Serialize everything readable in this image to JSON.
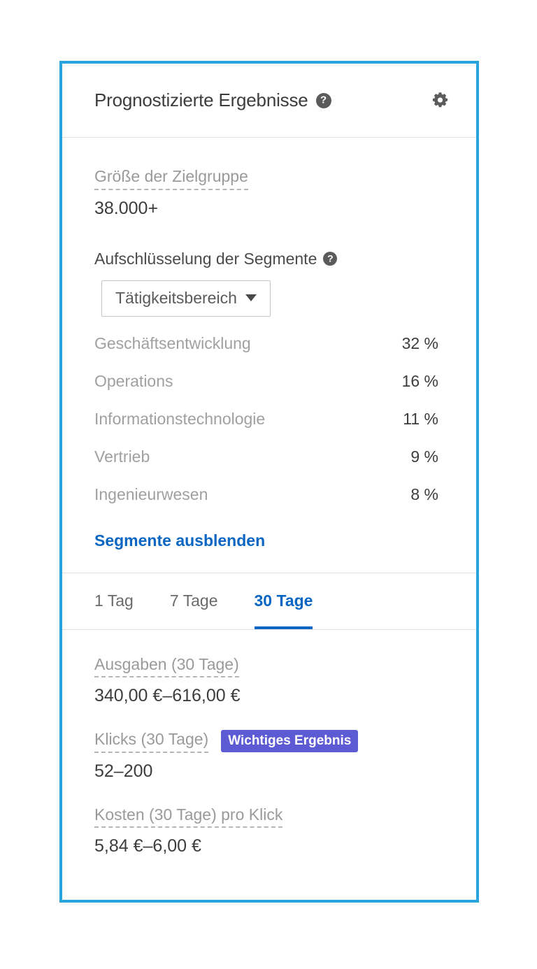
{
  "card": {
    "accent_border_color": "#29a3dc",
    "link_color": "#0a66c2",
    "badge_color": "#5d5bd4"
  },
  "header": {
    "title": "Prognostizierte Ergebnisse",
    "help_glyph": "?",
    "gear_icon_name": "gear-icon"
  },
  "audience": {
    "label": "Größe der Zielgruppe",
    "value": "38.000+"
  },
  "segments": {
    "heading": "Aufschlüsselung der Segmente",
    "help_glyph": "?",
    "dropdown": {
      "selected": "Tätigkeitsbereich"
    },
    "rows": [
      {
        "name": "Geschäftsentwicklung",
        "pct": "32 %"
      },
      {
        "name": "Operations",
        "pct": "16 %"
      },
      {
        "name": "Informationstechnologie",
        "pct": "11 %"
      },
      {
        "name": "Vertrieb",
        "pct": "9 %"
      },
      {
        "name": "Ingenieurwesen",
        "pct": "8 %"
      }
    ],
    "toggle_link": "Segmente ausblenden"
  },
  "tabs": [
    {
      "label": "1 Tag",
      "active": false
    },
    {
      "label": "7 Tage",
      "active": false
    },
    {
      "label": "30 Tage",
      "active": true
    }
  ],
  "results": {
    "spend": {
      "label": "Ausgaben (30 Tage)",
      "value": "340,00 €–616,00 €"
    },
    "clicks": {
      "label": "Klicks (30 Tage)",
      "badge": "Wichtiges Ergebnis",
      "value": "52–200"
    },
    "cost_per_click": {
      "label": "Kosten (30 Tage) pro Klick",
      "value": "5,84 €–6,00 €"
    }
  }
}
